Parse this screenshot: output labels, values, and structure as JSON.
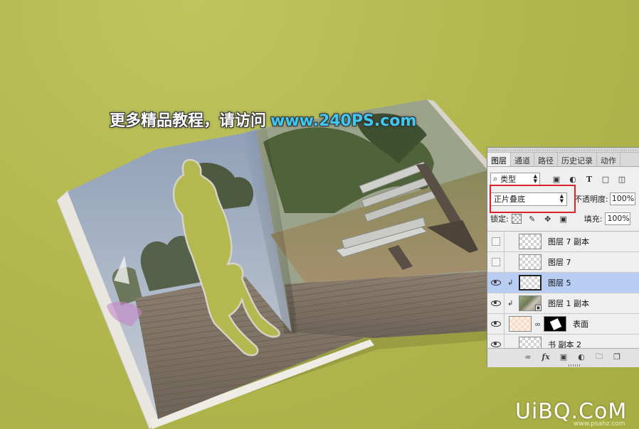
{
  "watermark": {
    "text_cn": "更多精品教程，请访问",
    "text_url": "www.240PS.com"
  },
  "brand": {
    "logo": "UiBQ.CoM",
    "sub": "www.psahz.com"
  },
  "layers_panel": {
    "tabs": [
      {
        "label": "图层",
        "active": true
      },
      {
        "label": "通道",
        "active": false
      },
      {
        "label": "路径",
        "active": false
      },
      {
        "label": "历史记录",
        "active": false
      },
      {
        "label": "动作",
        "active": false
      }
    ],
    "filter": {
      "label": "类型"
    },
    "filter_icons": [
      "image-filter-icon",
      "adjustment-filter-icon",
      "type-filter-icon",
      "shape-filter-icon",
      "smart-object-filter-icon"
    ],
    "blend_mode": "正片叠底",
    "opacity_label": "不透明度:",
    "opacity_value": "100%",
    "lock_label": "锁定:",
    "fill_label": "填充:",
    "fill_value": "100%",
    "layers": [
      {
        "name": "图层 7 副本",
        "visible": false,
        "selected": false
      },
      {
        "name": "图层 7",
        "visible": false,
        "selected": false
      },
      {
        "name": "图层 5",
        "visible": true,
        "selected": true
      },
      {
        "name": "图层 1 副本",
        "visible": true,
        "selected": false
      },
      {
        "name": "表面",
        "visible": true,
        "selected": false
      },
      {
        "name": "书 副本 2",
        "visible": true,
        "selected": false
      }
    ]
  },
  "colors": {
    "background": "#b3b84f",
    "selected_layer": "#b7cdf2",
    "highlight_box": "#d9242b",
    "watermark_url": "#3fc8f0"
  }
}
